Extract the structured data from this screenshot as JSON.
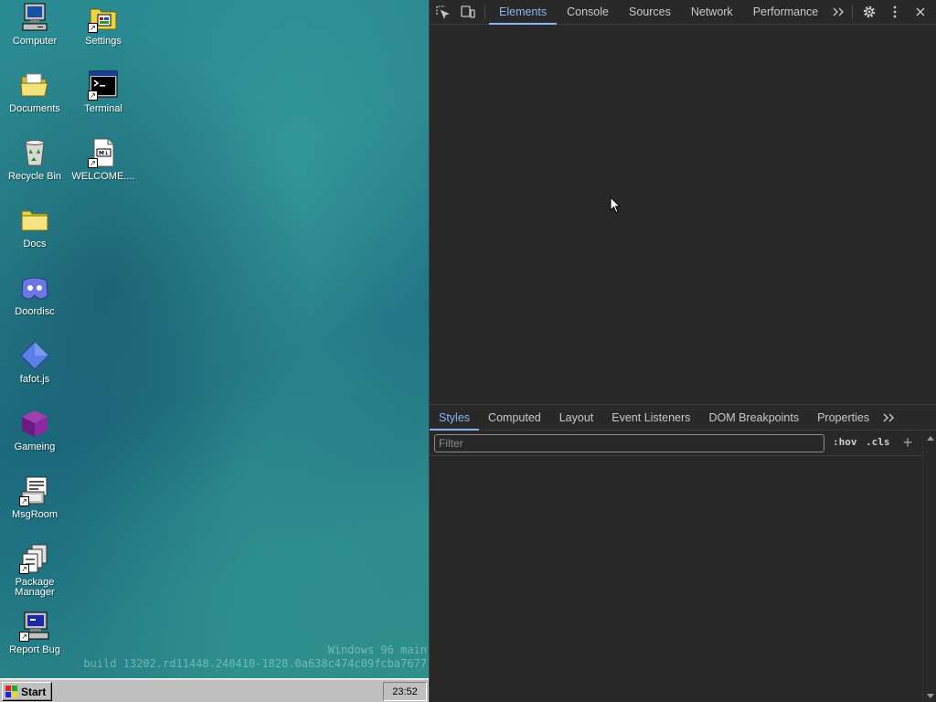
{
  "desktop": {
    "icons": [
      {
        "label": "Computer",
        "icon": "computer-icon"
      },
      {
        "label": "Settings",
        "icon": "settings-icon"
      },
      {
        "label": "Documents",
        "icon": "folder-open-icon"
      },
      {
        "label": "Terminal",
        "icon": "terminal-icon"
      },
      {
        "label": "Recycle Bin",
        "icon": "recycle-bin-icon"
      },
      {
        "label": "WELCOME....",
        "icon": "markdown-file-icon"
      },
      {
        "label": "Docs",
        "icon": "folder-icon"
      },
      {
        "label": "Doordisc",
        "icon": "doordisc-icon"
      },
      {
        "label": "fafot.js",
        "icon": "diamond-icon"
      },
      {
        "label": "Gameing",
        "icon": "game-cube-icon"
      },
      {
        "label": "MsgRoom",
        "icon": "msgroom-icon"
      },
      {
        "label": "Package Manager",
        "icon": "package-manager-icon"
      },
      {
        "label": "Report Bug",
        "icon": "report-bug-icon"
      }
    ],
    "watermark_line1": "Windows 96 main",
    "watermark_line2": "build 13202.rd11448.240410-1828.0a638c474c09fcba7677"
  },
  "taskbar": {
    "start_label": "Start",
    "clock": "23:52"
  },
  "devtools": {
    "toolbar_icons": [
      "inspect-element-icon",
      "device-toolbar-icon",
      "more-tabs-icon",
      "settings-gear-icon",
      "kebab-menu-icon",
      "close-icon"
    ],
    "tabs": [
      "Elements",
      "Console",
      "Sources",
      "Network",
      "Performance"
    ],
    "active_tab": "Elements",
    "sub_tabs": [
      "Styles",
      "Computed",
      "Layout",
      "Event Listeners",
      "DOM Breakpoints",
      "Properties"
    ],
    "active_sub_tab": "Styles",
    "filter_placeholder": "Filter",
    "hov_label": ":hov",
    "cls_label": ".cls",
    "accent_color": "#8ab4f8"
  }
}
